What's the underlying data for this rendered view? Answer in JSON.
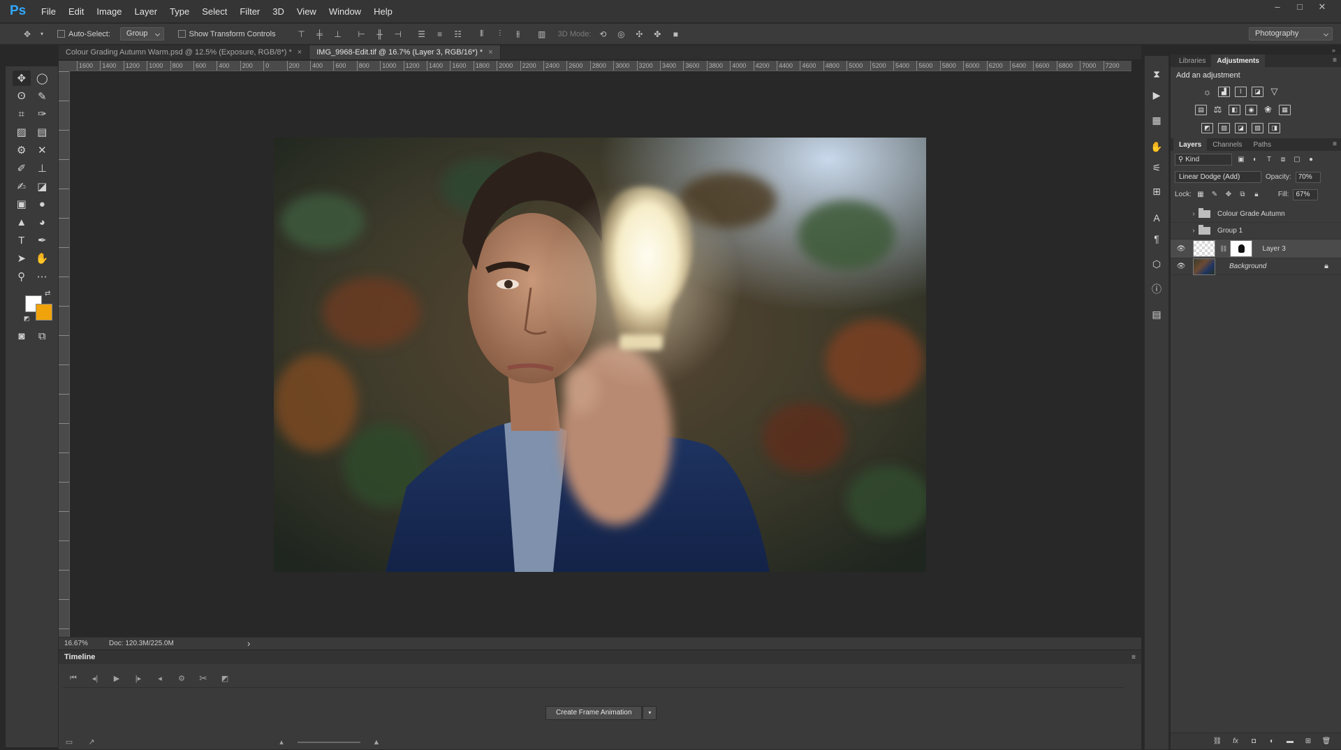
{
  "menu": {
    "logo": "Ps",
    "items": [
      "File",
      "Edit",
      "Image",
      "Layer",
      "Type",
      "Select",
      "Filter",
      "3D",
      "View",
      "Window",
      "Help"
    ]
  },
  "window_controls": [
    "–",
    "□",
    "✕"
  ],
  "options": {
    "auto_select_label": "Auto-Select:",
    "auto_select_value": "Group",
    "show_transform_label": "Show Transform Controls",
    "mode_3d_label": "3D Mode:",
    "workspace": "Photography"
  },
  "tabs": [
    {
      "label": "Colour Grading Autumn Warm.psd @ 12.5% (Exposure, RGB/8*) *",
      "close": "×"
    },
    {
      "label": "IMG_9968-Edit.tif @ 16.7% (Layer 3, RGB/16*) *",
      "close": "×"
    }
  ],
  "ruler_top": [
    "1600",
    "1400",
    "1200",
    "1000",
    "800",
    "600",
    "400",
    "200",
    "0",
    "200",
    "400",
    "600",
    "800",
    "1000",
    "1200",
    "1400",
    "1600",
    "1800",
    "2000",
    "2200",
    "2400",
    "2600",
    "2800",
    "3000",
    "3200",
    "3400",
    "3600",
    "3800",
    "4000",
    "4200",
    "4400",
    "4600",
    "4800",
    "5000",
    "5200",
    "5400",
    "5600",
    "5800",
    "6000",
    "6200",
    "6400",
    "6600",
    "6800",
    "7000",
    "7200"
  ],
  "status": {
    "zoom": "16.67%",
    "doc": "Doc: 120.3M/225.0M",
    "arrow": "›"
  },
  "timeline": {
    "title": "Timeline",
    "create_button": "Create Frame Animation",
    "create_arrow": "▾"
  },
  "adjustments": {
    "tabs": [
      "Libraries",
      "Adjustments"
    ],
    "title": "Add an adjustment"
  },
  "layers": {
    "tabs": [
      "Layers",
      "Channels",
      "Paths"
    ],
    "filter_kind": "Kind",
    "blend_mode": "Linear Dodge (Add)",
    "opacity_label": "Opacity:",
    "opacity_value": "70%",
    "lock_label": "Lock:",
    "fill_label": "Fill:",
    "fill_value": "67%",
    "items": [
      {
        "name": "Colour Grade Autumn",
        "visible": false,
        "kind": "group"
      },
      {
        "name": "Group 1",
        "visible": false,
        "kind": "group"
      },
      {
        "name": "Layer 3",
        "visible": true,
        "kind": "layer-masked",
        "selected": true
      },
      {
        "name": "Background",
        "visible": true,
        "kind": "background",
        "locked": true
      }
    ]
  },
  "colors": {
    "foreground": "#ffffff",
    "background": "#f0a30a",
    "accent": "#31a8ff"
  }
}
